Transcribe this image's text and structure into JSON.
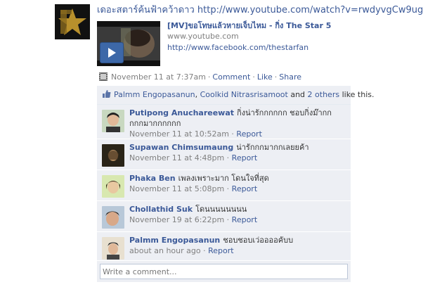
{
  "post": {
    "page_name": "เดอะสตาร์ค้นฟ้าคว้าดาว",
    "link_url": "http://www.youtube.com/watch?v=rwdyvgCw9ug",
    "attachment": {
      "title": "[MV]ขอโทษแล้วหายเจ็บไหม - กิ่ง The Star 5",
      "source": "www.youtube.com",
      "description": "http://www.facebook.com/thestarfan"
    },
    "timestamp": "November 11 at 7:37am",
    "actions": {
      "comment": "Comment",
      "like": "Like",
      "share": "Share"
    }
  },
  "likes": {
    "user1": "Palmm Engopasanun",
    "user2": "Coolkid Nitrasrisamoot",
    "and_text": "and",
    "others": "2 others",
    "suffix": "like this."
  },
  "comments": [
    {
      "author": "Putipong Anuchareewat",
      "text": "กิ่งน่ารักกกกกก ชอบกิ่งม๊ากกกกกมากกกกกก",
      "time": "November 11 at 10:52am",
      "report": "Report"
    },
    {
      "author": "Supawan Chimsumaung",
      "text": "น่ารักกกมากกเลยยค้า",
      "time": "November 11 at 4:48pm",
      "report": "Report"
    },
    {
      "author": "Phaka Ben",
      "text": "เพลงเพราะมาก โดนใจที่สุด",
      "time": "November 11 at 5:08pm",
      "report": "Report"
    },
    {
      "author": "Chollathid Suk",
      "text": "โดนนนนนนนน",
      "time": "November 19 at 6:22pm",
      "report": "Report"
    },
    {
      "author": "Palmm Engopasanun",
      "text": "ชอบชอบเว่ออออคับบ",
      "time": "about an hour ago",
      "report": "Report"
    }
  ],
  "write_comment": {
    "placeholder": "Write a comment..."
  },
  "colors": {
    "link": "#3b5998",
    "ufi_bg": "#edeff4",
    "meta_gray": "#808080"
  }
}
